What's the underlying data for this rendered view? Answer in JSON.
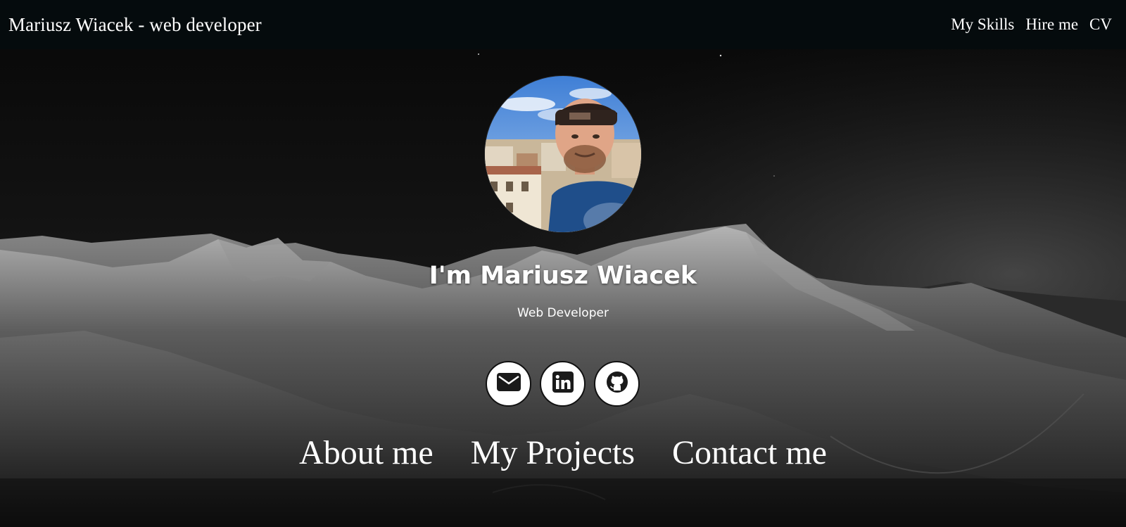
{
  "header": {
    "brand": "Mariusz Wiacek - web developer",
    "nav": [
      "My Skills",
      "Hire me",
      "CV"
    ]
  },
  "hero": {
    "name": "I'm Mariusz Wiacek",
    "role": "Web Developer"
  },
  "socials": [
    {
      "icon": "mail-icon",
      "label": "Email"
    },
    {
      "icon": "linkedin-icon",
      "label": "LinkedIn"
    },
    {
      "icon": "github-icon",
      "label": "GitHub"
    }
  ],
  "sections": [
    "About me",
    "My Projects",
    "Contact me"
  ],
  "colors": {
    "topbar": "#050b0d",
    "text": "#ffffff",
    "icon_bg": "#ffffff",
    "icon_fg": "#1a1a1a"
  }
}
